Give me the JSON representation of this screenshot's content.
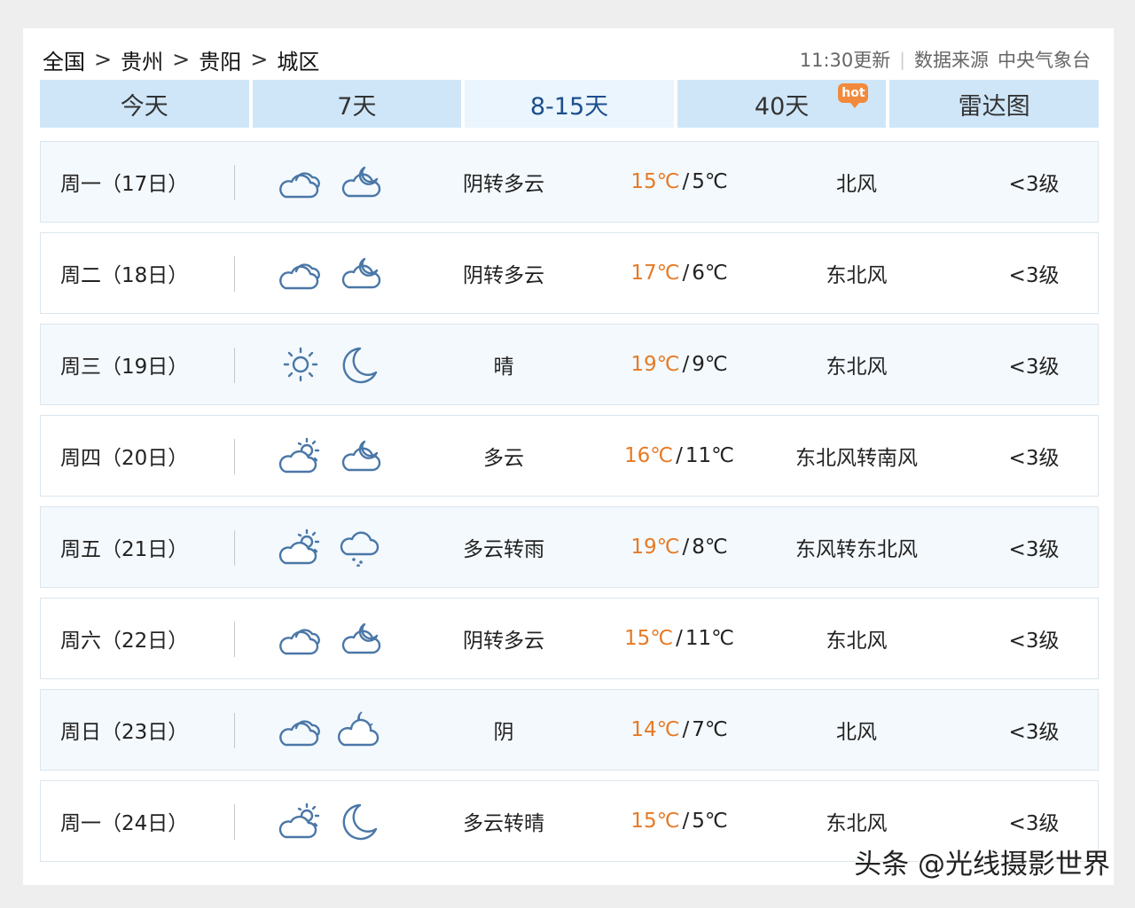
{
  "breadcrumb": {
    "items": [
      "全国",
      "贵州",
      "贵阳",
      "城区"
    ],
    "separator": ">"
  },
  "header_meta": {
    "update_time": "11:30更新",
    "divider": "|",
    "source_label": "数据来源",
    "source_name": "中央气象台"
  },
  "tabs": [
    {
      "label": "今天",
      "active": false
    },
    {
      "label": "7天",
      "active": false
    },
    {
      "label": "8-15天",
      "active": true
    },
    {
      "label": "40天",
      "active": false,
      "badge": "hot"
    },
    {
      "label": "雷达图",
      "active": false
    }
  ],
  "colors": {
    "tab_bg": "#cfe6f8",
    "tab_active_bg": "#eaf5fe",
    "tab_active_text": "#1c4f8c",
    "hi_temp": "#e67a25",
    "row_alt_bg": "#f4f9fd",
    "icon_stroke": "#4a77a7",
    "hot_badge": "#f28a3d"
  },
  "forecast": [
    {
      "day": "周一（17日）",
      "icon_day": "cloudy-icon",
      "icon_night": "partly-cloudy-night-icon",
      "desc": "阴转多云",
      "high": "15℃",
      "low": "5℃",
      "wind": "北风",
      "level": "<3级"
    },
    {
      "day": "周二（18日）",
      "icon_day": "cloudy-icon",
      "icon_night": "partly-cloudy-night-icon",
      "desc": "阴转多云",
      "high": "17℃",
      "low": "6℃",
      "wind": "东北风",
      "level": "<3级"
    },
    {
      "day": "周三（19日）",
      "icon_day": "sun-icon",
      "icon_night": "moon-icon",
      "desc": "晴",
      "high": "19℃",
      "low": "9℃",
      "wind": "东北风",
      "level": "<3级"
    },
    {
      "day": "周四（20日）",
      "icon_day": "partly-cloudy-day-icon",
      "icon_night": "partly-cloudy-night-icon",
      "desc": "多云",
      "high": "16℃",
      "low": "11℃",
      "wind": "东北风转南风",
      "level": "<3级"
    },
    {
      "day": "周五（21日）",
      "icon_day": "partly-cloudy-day-icon",
      "icon_night": "rain-icon",
      "desc": "多云转雨",
      "high": "19℃",
      "low": "8℃",
      "wind": "东风转东北风",
      "level": "<3级"
    },
    {
      "day": "周六（22日）",
      "icon_day": "cloudy-icon",
      "icon_night": "partly-cloudy-night-icon",
      "desc": "阴转多云",
      "high": "15℃",
      "low": "11℃",
      "wind": "东北风",
      "level": "<3级"
    },
    {
      "day": "周日（23日）",
      "icon_day": "cloudy-icon",
      "icon_night": "cloudy-night-moon-icon",
      "desc": "阴",
      "high": "14℃",
      "low": "7℃",
      "wind": "北风",
      "level": "<3级"
    },
    {
      "day": "周一（24日）",
      "icon_day": "partly-cloudy-day-icon",
      "icon_night": "moon-icon",
      "desc": "多云转晴",
      "high": "15℃",
      "low": "5℃",
      "wind": "东北风",
      "level": "<3级"
    }
  ],
  "watermark": "头条 @光线摄影世界"
}
